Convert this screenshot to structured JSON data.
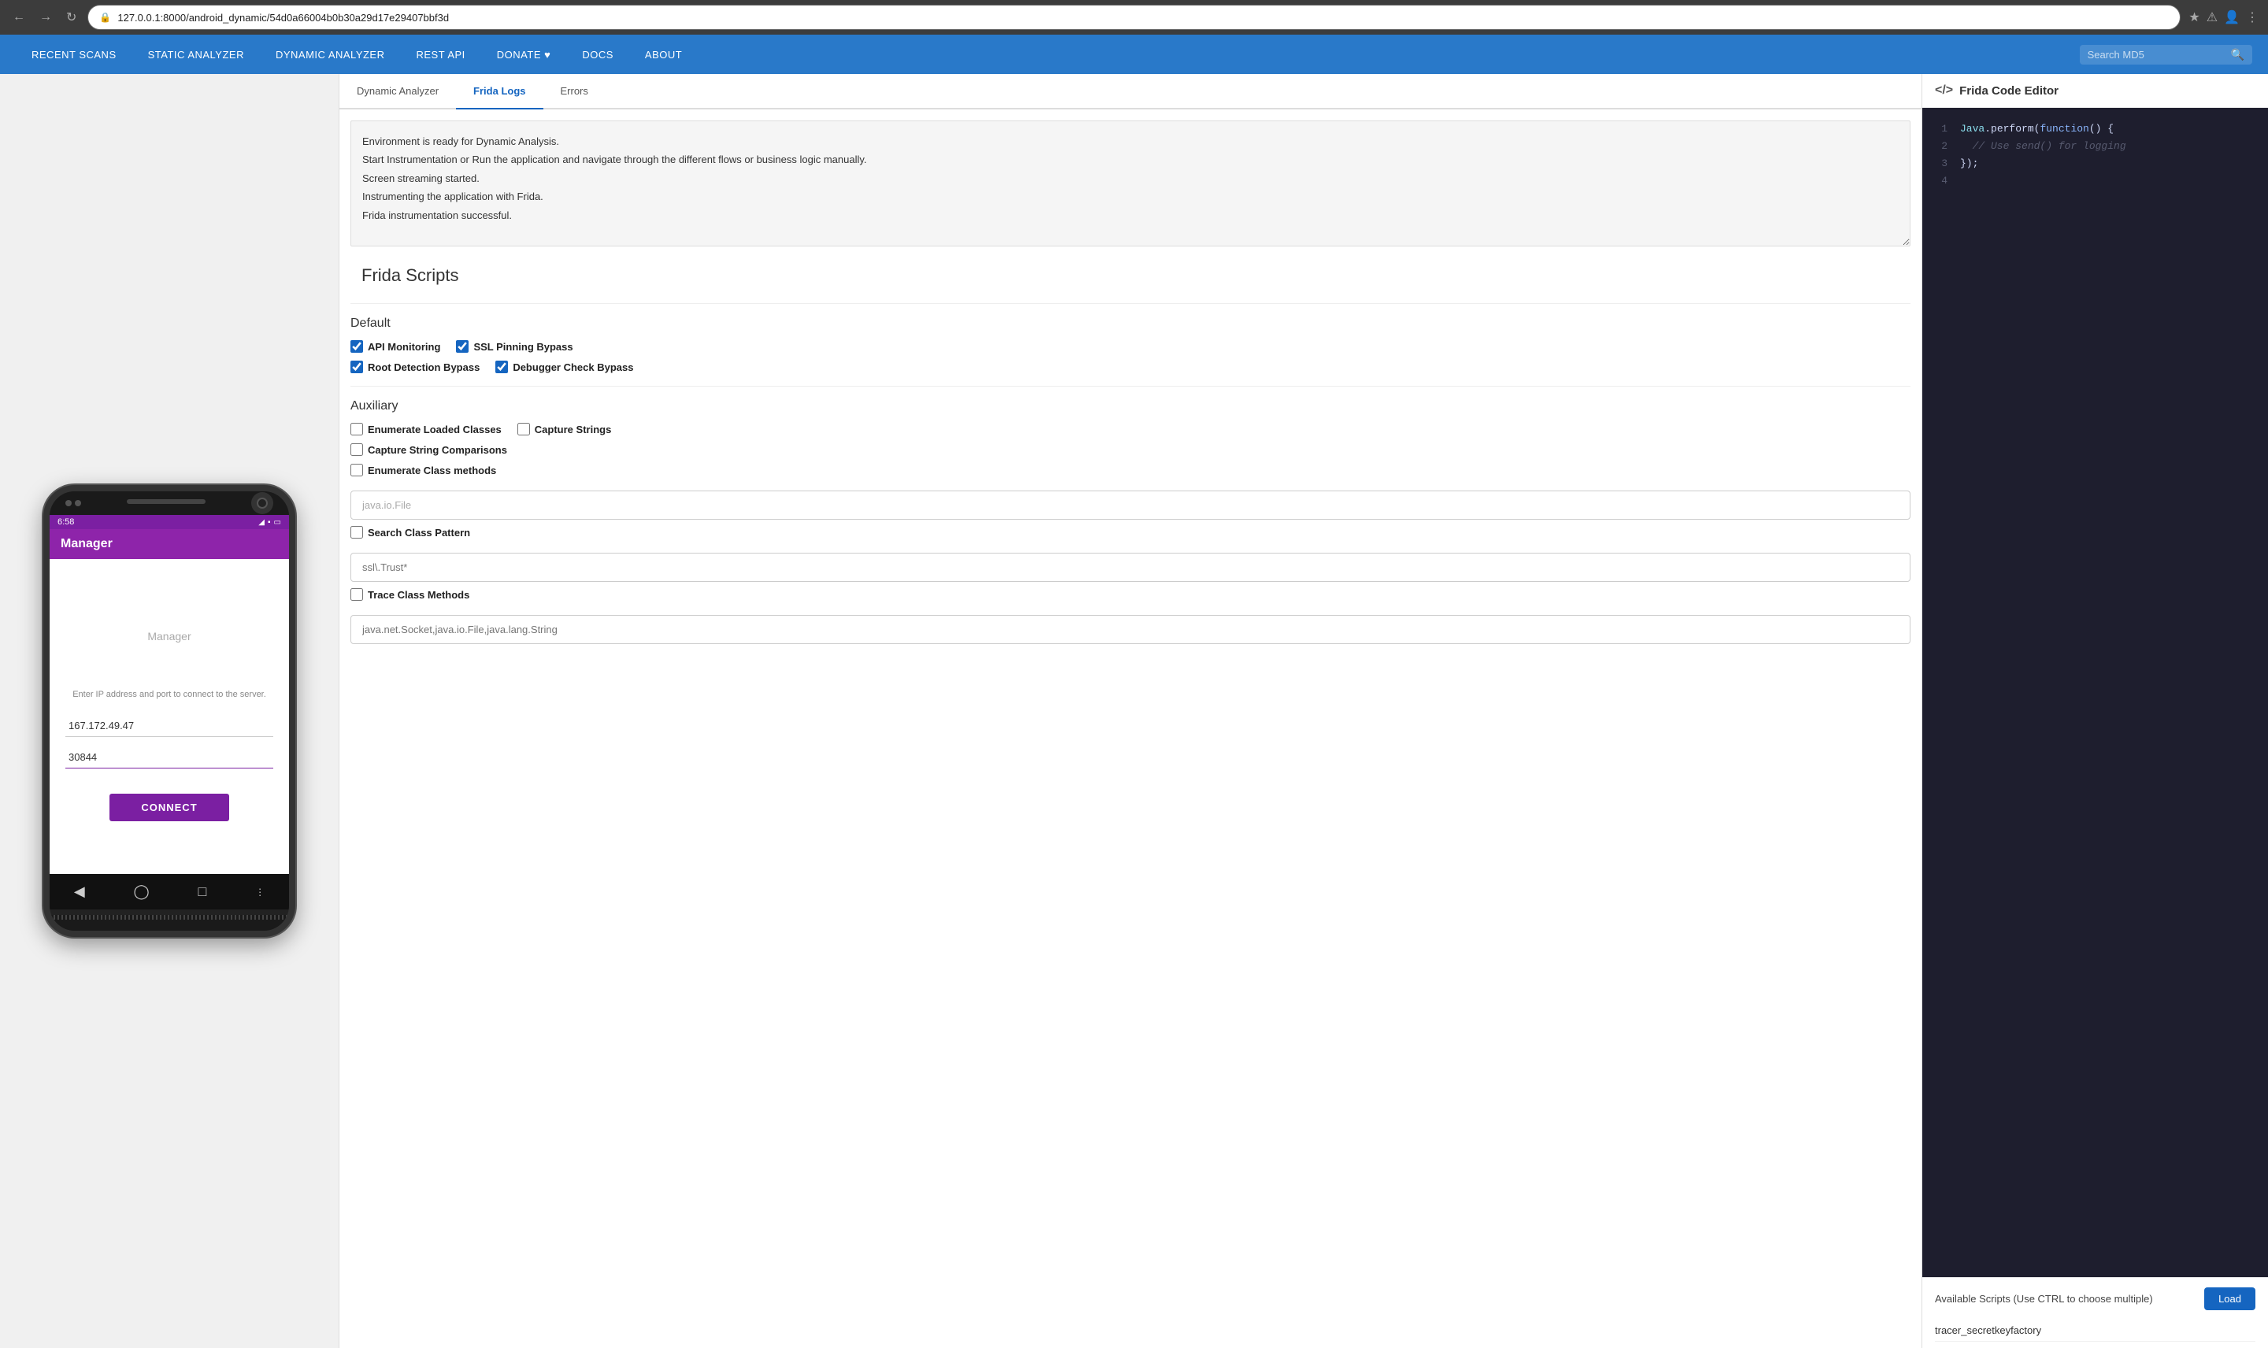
{
  "browser": {
    "url": "127.0.0.1:8000/android_dynamic/54d0a66004b0b30a29d17e29407bbf3d",
    "full_url": "127.0.0.1:8000/android_dynamic/54d0a66004b0b30a29d17e29407bbf3d"
  },
  "nav": {
    "items": [
      {
        "label": "RECENT SCANS",
        "id": "recent-scans"
      },
      {
        "label": "STATIC ANALYZER",
        "id": "static-analyzer"
      },
      {
        "label": "DYNAMIC ANALYZER",
        "id": "dynamic-analyzer"
      },
      {
        "label": "REST API",
        "id": "rest-api"
      },
      {
        "label": "DONATE ♥",
        "id": "donate"
      },
      {
        "label": "DOCS",
        "id": "docs"
      },
      {
        "label": "ABOUT",
        "id": "about"
      }
    ],
    "search_placeholder": "Search MD5"
  },
  "phone": {
    "time": "6:58",
    "app_title": "Manager",
    "manager_label": "Manager",
    "instruction": "Enter IP address and port to connect to the server.",
    "ip_value": "167.172.49.47",
    "port_value": "30844",
    "connect_label": "CONNECT"
  },
  "middle": {
    "tabs": [
      {
        "label": "Dynamic Analyzer",
        "id": "dynamic-analyzer"
      },
      {
        "label": "Frida Logs",
        "id": "frida-logs",
        "active": true
      },
      {
        "label": "Errors",
        "id": "errors"
      }
    ],
    "log_lines": [
      "Environment is ready for Dynamic Analysis.",
      "Start Instrumentation or Run the application and navigate through the different flows or business logic manually.",
      "Screen streaming started.",
      "Instrumenting the application with Frida.",
      "Frida instrumentation successful."
    ],
    "frida_scripts_title": "Frida Scripts",
    "default_section": {
      "title": "Default",
      "checkboxes": [
        {
          "label": "API Monitoring",
          "checked": true,
          "id": "api-monitoring"
        },
        {
          "label": "SSL Pinning Bypass",
          "checked": true,
          "id": "ssl-pinning"
        },
        {
          "label": "Root Detection Bypass",
          "checked": true,
          "id": "root-detection"
        },
        {
          "label": "Debugger Check Bypass",
          "checked": true,
          "id": "debugger-check"
        }
      ]
    },
    "auxiliary_section": {
      "title": "Auxiliary",
      "checkboxes": [
        {
          "label": "Enumerate Loaded Classes",
          "checked": false,
          "id": "enum-classes"
        },
        {
          "label": "Capture Strings",
          "checked": false,
          "id": "capture-strings"
        },
        {
          "label": "Capture String Comparisons",
          "checked": false,
          "id": "capture-comparisons"
        },
        {
          "label": "Enumerate Class methods",
          "checked": false,
          "id": "enum-methods"
        }
      ],
      "class_pattern_input": "java.io.File",
      "class_pattern_label": "Search Class Pattern",
      "class_pattern_checked": false,
      "search_class_placeholder": "ssl\\.Trust*",
      "trace_methods_label": "Trace Class Methods",
      "trace_methods_checked": false,
      "trace_input_placeholder": "java.net.Socket,java.io.File,java.lang.String"
    }
  },
  "right_panel": {
    "title": "Frida Code Editor",
    "code_icon": "</>",
    "code_lines": [
      {
        "num": 1,
        "content": "Java.perform(function() {"
      },
      {
        "num": 2,
        "content": "  // Use send() for logging"
      },
      {
        "num": 3,
        "content": "});"
      },
      {
        "num": 4,
        "content": ""
      }
    ],
    "available_scripts_label": "Available Scripts (Use CTRL to choose multiple)",
    "load_label": "Load",
    "scripts": [
      {
        "name": "tracer_secretkeyfactory"
      }
    ]
  }
}
